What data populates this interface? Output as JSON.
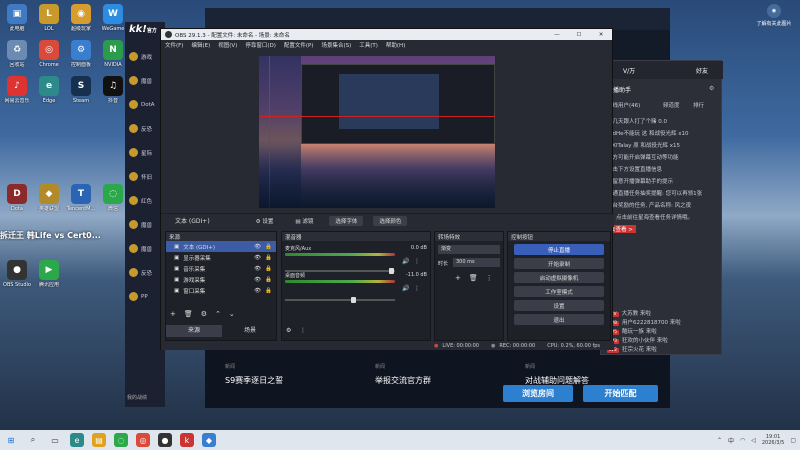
{
  "desktop_icons": [
    {
      "label": "此电脑",
      "color": "#3f7bc5",
      "glyph": "▣"
    },
    {
      "label": "LOL",
      "color": "#c79a2b",
      "glyph": "L"
    },
    {
      "label": "超级玩家",
      "color": "#d69d2e",
      "glyph": "◉"
    },
    {
      "label": "WeGame",
      "color": "#2c8de0",
      "glyph": "W"
    },
    {
      "label": "回收站",
      "color": "#6b8bb3",
      "glyph": "♻"
    },
    {
      "label": "Chrome",
      "color": "#d94a3b",
      "glyph": "◎"
    },
    {
      "label": "控制面板",
      "color": "#3a7fcf",
      "glyph": "⚙"
    },
    {
      "label": "NVIDIA",
      "color": "#2b9c4b",
      "glyph": "N"
    },
    {
      "label": "网易云音乐",
      "color": "#d33",
      "glyph": "♪"
    },
    {
      "label": "Edge",
      "color": "#2c8a8a",
      "glyph": "e"
    },
    {
      "label": "Steam",
      "color": "#16304f",
      "glyph": "S"
    },
    {
      "label": "抖音",
      "color": "#111",
      "glyph": "♫"
    },
    {
      "label": "Dota",
      "color": "#8a2a2a",
      "glyph": "D"
    },
    {
      "label": "英雄联盟",
      "color": "#b38a2a",
      "glyph": "◆"
    },
    {
      "label": "TencentM...",
      "color": "#2a64b3",
      "glyph": "T"
    },
    {
      "label": "微信",
      "color": "#2aa84a",
      "glyph": "◌"
    },
    {
      "label": "OBS Studio",
      "color": "#333",
      "glyph": "●"
    },
    {
      "label": "腾讯应用",
      "color": "#2aa84a",
      "glyph": "▶"
    }
  ],
  "left_banner": "拆迁王 韩Life vs Cert0...",
  "game_client": {
    "logo": "kk!",
    "logo_suffix": "官方",
    "side_items": [
      "游戏",
      "魔兽",
      "DotA",
      "反恐",
      "星际",
      "怀旧",
      "红色",
      "魔兽",
      "魔兽",
      "反恐",
      "PP"
    ],
    "news_label_1": "新闻",
    "news_1": "S9赛季逐日之誓",
    "news_label_2": "新闻",
    "news_2": "举报交流官方群",
    "news_label_3": "新闻",
    "news_3": "对战辅助问题解答",
    "btn_browse": "浏览房间",
    "btn_match": "开始匹配",
    "bottom_link": "我的战绩"
  },
  "chat": {
    "tab1": "V/万",
    "tab2": "好友",
    "title": "开播助手",
    "online": "在线用户(46)",
    "col2": "频道度",
    "col3": "排行",
    "lines": [
      "前几天跟人打了个赌 0.0",
      "在dHe不能玩 这 和战役光辉 x10",
      "000Talay 原 和战役光辉 x15",
      "下方可能开启弹幕互动等功能",
      "点击下方设置直播信息",
      "请留意开播弹幕助手的提示",
      "开通直播任务抽奖提醒: 您可以再领1张",
      "平台奖励的任务, 产品名称: 风之夜",
      "青, 点击前往星海查看任务详情哦。",
      "去查看 >"
    ],
    "users": [
      {
        "badge": "大V",
        "name": "大苏教 来啦"
      },
      {
        "badge": "LV8",
        "name": "用户6222818700 来啦"
      },
      {
        "badge": "LV5",
        "name": "酷玩一族 来啦"
      },
      {
        "badge": "LV3",
        "name": "狂欢的小伙伴 来啦"
      },
      {
        "badge": "LV2",
        "name": "狂宗火花 来啦"
      }
    ]
  },
  "obs": {
    "title": "OBS 29.1.3 - 配置文件: 未命名 - 场景: 未命名",
    "menu": [
      "文件(F)",
      "编辑(E)",
      "视图(V)",
      "停靠窗口(D)",
      "配置文件(P)",
      "场景集合(S)",
      "工具(T)",
      "帮助(H)"
    ],
    "source_label": "文本 (GDI+)",
    "source_bar_buttons": [
      "设置",
      "滤镜",
      "选择字体",
      "选择颜色"
    ],
    "docks": {
      "sources": {
        "title": "来源",
        "items": [
          "文本 (GDI+)",
          "显示器采集",
          "音乐采集",
          "游戏采集",
          "窗口采集"
        ]
      },
      "mixer": {
        "title": "混音器",
        "ch1_name": "麦克风/Aux",
        "ch1_db": "0.0 dB",
        "ch2_name": "桌面音频",
        "ch2_db": "-11.0 dB"
      },
      "transitions": {
        "title": "转场特效",
        "type": "渐变",
        "duration_label": "时长",
        "duration": "300 ms"
      },
      "controls": {
        "title": "控制按钮",
        "buttons": [
          "停止直播",
          "开始录制",
          "启动虚拟摄像机",
          "工作室模式",
          "设置",
          "退出"
        ]
      }
    },
    "scene_tabs": [
      "来源",
      "场景"
    ],
    "status": {
      "live": "LIVE: 00:00:00",
      "rec": "REC: 00:00:00",
      "cpu": "CPU: 0.2%, 60.00 fps"
    }
  },
  "taskbar": {
    "time": "19:01",
    "date": "2026/3/5",
    "tray_text": "中",
    "notif": "了解有关此图片"
  },
  "corner_notice": "了解有关此图片\n的信息"
}
